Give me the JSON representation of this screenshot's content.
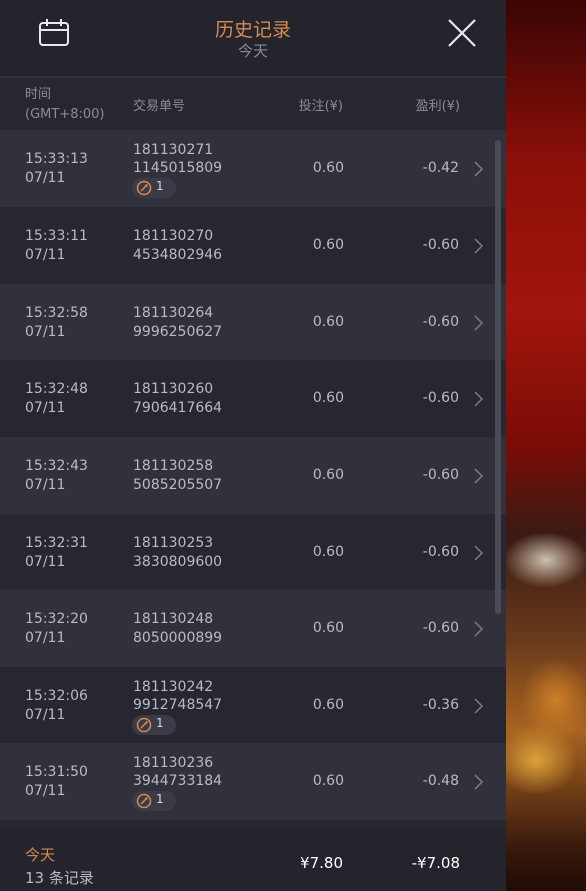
{
  "header": {
    "title": "历史记录",
    "subtitle": "今天",
    "calendar_icon": "calendar-icon",
    "close_icon": "close-icon"
  },
  "columns": {
    "time": "时间",
    "timezone": "(GMT+8:00)",
    "order": "交易单号",
    "bet": "投注(¥)",
    "pnl": "盈利(¥)"
  },
  "rows": [
    {
      "time": "15:33:13",
      "date": "07/11",
      "order1": "181130271",
      "order2": "1145015809",
      "bet": "0.60",
      "pnl": "-0.42",
      "badge": "1"
    },
    {
      "time": "15:33:11",
      "date": "07/11",
      "order1": "181130270",
      "order2": "4534802946",
      "bet": "0.60",
      "pnl": "-0.60"
    },
    {
      "time": "15:32:58",
      "date": "07/11",
      "order1": "181130264",
      "order2": "9996250627",
      "bet": "0.60",
      "pnl": "-0.60"
    },
    {
      "time": "15:32:48",
      "date": "07/11",
      "order1": "181130260",
      "order2": "7906417664",
      "bet": "0.60",
      "pnl": "-0.60"
    },
    {
      "time": "15:32:43",
      "date": "07/11",
      "order1": "181130258",
      "order2": "5085205507",
      "bet": "0.60",
      "pnl": "-0.60"
    },
    {
      "time": "15:32:31",
      "date": "07/11",
      "order1": "181130253",
      "order2": "3830809600",
      "bet": "0.60",
      "pnl": "-0.60"
    },
    {
      "time": "15:32:20",
      "date": "07/11",
      "order1": "181130248",
      "order2": "8050000899",
      "bet": "0.60",
      "pnl": "-0.60"
    },
    {
      "time": "15:32:06",
      "date": "07/11",
      "order1": "181130242",
      "order2": "9912748547",
      "bet": "0.60",
      "pnl": "-0.36",
      "badge": "1"
    },
    {
      "time": "15:31:50",
      "date": "07/11",
      "order1": "181130236",
      "order2": "3944733184",
      "bet": "0.60",
      "pnl": "-0.48",
      "badge": "1"
    }
  ],
  "footer": {
    "today": "今天",
    "count": "13 条记录",
    "total_bet": "¥7.80",
    "total_pnl": "-¥7.08"
  },
  "colors": {
    "accent": "#d98a4e",
    "panel": "#262730",
    "row_alt": "#30313b",
    "text": "#b9bbc4"
  }
}
